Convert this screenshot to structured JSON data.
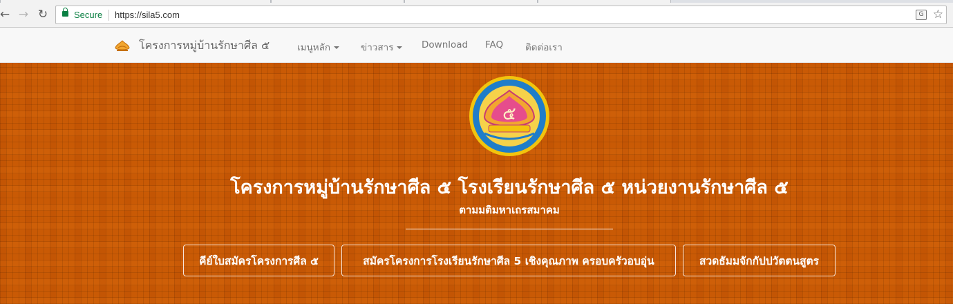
{
  "browser": {
    "secure_label": "Secure",
    "url": "https://sila5.com",
    "back_glyph": "←",
    "forward_glyph": "→",
    "reload_glyph": "↻",
    "translate_glyph": "G",
    "star_glyph": "☆",
    "icons": [
      "back-icon",
      "forward-icon",
      "reload-icon",
      "lock-icon",
      "translate-icon",
      "star-icon"
    ]
  },
  "navbar": {
    "brand": "โครงการหมู่บ้านรักษาศีล ๕",
    "brand_icon": "sila-brand-icon",
    "items": [
      {
        "label": "เมนูหลัก",
        "dropdown": true
      },
      {
        "label": "ข่าวสาร",
        "dropdown": true
      },
      {
        "label": "Download",
        "dropdown": false
      },
      {
        "label": "FAQ",
        "dropdown": false
      },
      {
        "label": "ติดต่อเรา",
        "dropdown": false
      }
    ]
  },
  "hero": {
    "background": "#c95a05",
    "logo_icon": "sila5-emblem-logo",
    "logo_numeral": "๕",
    "title": "โครงการหมู่บ้านรักษาศีล ๕ โรงเรียนรักษาศีล ๕ หน่วยงานรักษาศีล ๕",
    "subtitle": "ตามมติมหาเถรสมาคม",
    "buttons": [
      {
        "label": "คีย์ใบสมัครโครงการศีล ๕"
      },
      {
        "label": "สมัครโครงการโรงเรียนรักษาศีล 5 เชิงคุณภาพ ครอบครัวอบอุ่น"
      },
      {
        "label": "สวดธัมมจักกัปปวัตตนสูตร"
      }
    ]
  }
}
